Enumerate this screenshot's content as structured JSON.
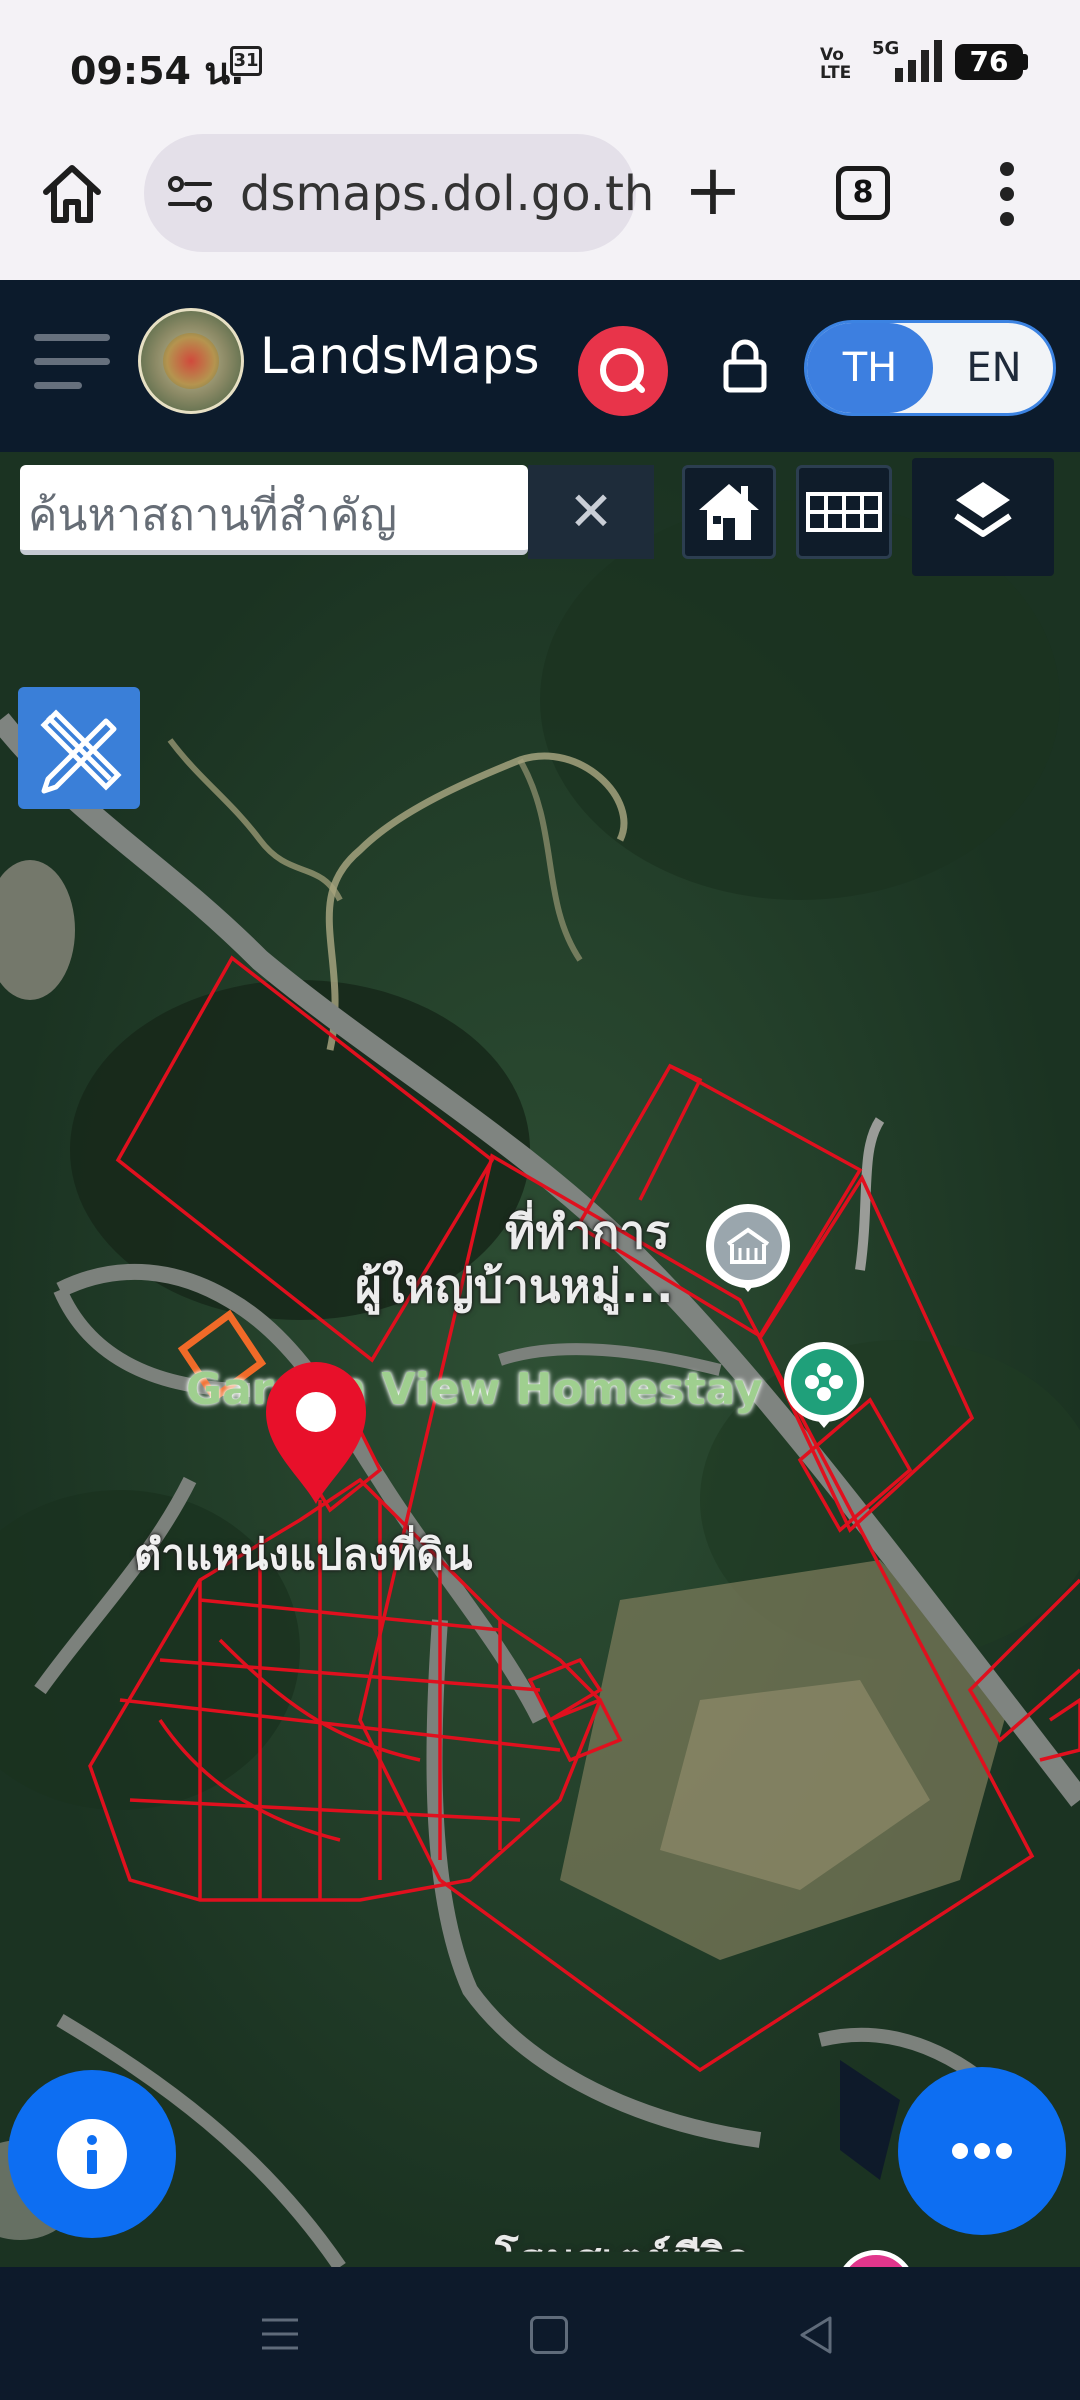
{
  "status_bar": {
    "time": "09:54 น.",
    "calendar_day": "31",
    "volte": "Vo LTE",
    "network": "5G",
    "battery": "76"
  },
  "browser": {
    "url": "dsmaps.dol.go.th",
    "tab_count": "8"
  },
  "app": {
    "brand": "LandsMaps",
    "lang_th": "TH",
    "lang_en": "EN"
  },
  "map_controls": {
    "search_placeholder": "ค้นหาสถานที่สำคัญ",
    "clear_label": "✕"
  },
  "map_labels": {
    "office_line1": "ที่ทำการ",
    "office_line2": "ผู้ใหญ่บ้านหมู่...",
    "homestay": "Garden View Homestay",
    "parcel_position": "ตำแหน่งแปลงที่ดิน",
    "bottom_place": "โฮมสเตย์ซีวิว"
  },
  "colors": {
    "header_bg": "#0c1b2c",
    "accent_blue": "#0d6ef2",
    "search_red": "#e8344a",
    "parcel_line": "#e0101e"
  }
}
